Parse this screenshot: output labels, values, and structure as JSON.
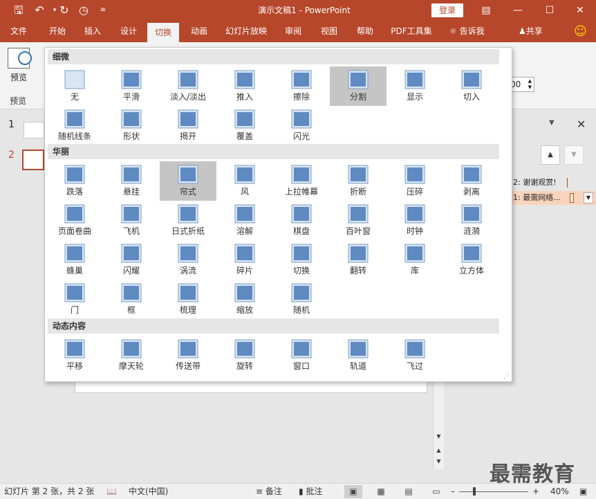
{
  "titlebar": {
    "title": "演示文稿1 - PowerPoint",
    "login": "登录",
    "save_icon": "save-icon",
    "undo_icon": "undo-icon",
    "redo_icon": "redo-icon"
  },
  "tabs": [
    {
      "label": "文件"
    },
    {
      "label": "开始"
    },
    {
      "label": "插入"
    },
    {
      "label": "设计"
    },
    {
      "label": "切换"
    },
    {
      "label": "动画"
    },
    {
      "label": "幻灯片放映"
    },
    {
      "label": "审阅"
    },
    {
      "label": "视图"
    },
    {
      "label": "帮助"
    },
    {
      "label": "PDF工具集"
    }
  ],
  "tell_me": "告诉我",
  "share": "共享",
  "ribbon": {
    "preview_label": "预览",
    "preview_group": "预览",
    "duration_value": "00"
  },
  "thumbnails": {
    "slide1_num": "1",
    "slide2_num": "2"
  },
  "pane": {
    "item1": "2: 谢谢观赏!",
    "item2": "1: 最需网络..."
  },
  "status": {
    "slide_info": "幻灯片 第 2 张，共 2 张",
    "language": "中文(中国)",
    "notes": "备注",
    "comments": "批注",
    "zoom": "40%"
  },
  "watermark": "最需教育",
  "gallery": {
    "sections": [
      {
        "title": "细微"
      },
      {
        "title": "华丽"
      },
      {
        "title": "动态内容"
      }
    ],
    "subtle": [
      "无",
      "平滑",
      "淡入/淡出",
      "推入",
      "擦除",
      "分割",
      "显示",
      "切入",
      "随机线条",
      "形状",
      "揭开",
      "覆盖",
      "闪光"
    ],
    "exciting": [
      "跌落",
      "悬挂",
      "帘式",
      "风",
      "上拉帷幕",
      "折断",
      "压碎",
      "剥离",
      "页面卷曲",
      "飞机",
      "日式折纸",
      "溶解",
      "棋盘",
      "百叶窗",
      "时钟",
      "涟漪",
      "蜂巢",
      "闪耀",
      "涡流",
      "碎片",
      "切换",
      "翻转",
      "库",
      "立方体",
      "门",
      "框",
      "梳理",
      "缩放",
      "随机"
    ],
    "dynamic": [
      "平移",
      "摩天轮",
      "传送带",
      "旋转",
      "窗口",
      "轨道",
      "飞过"
    ],
    "selected": [
      "分割",
      "帘式"
    ]
  }
}
